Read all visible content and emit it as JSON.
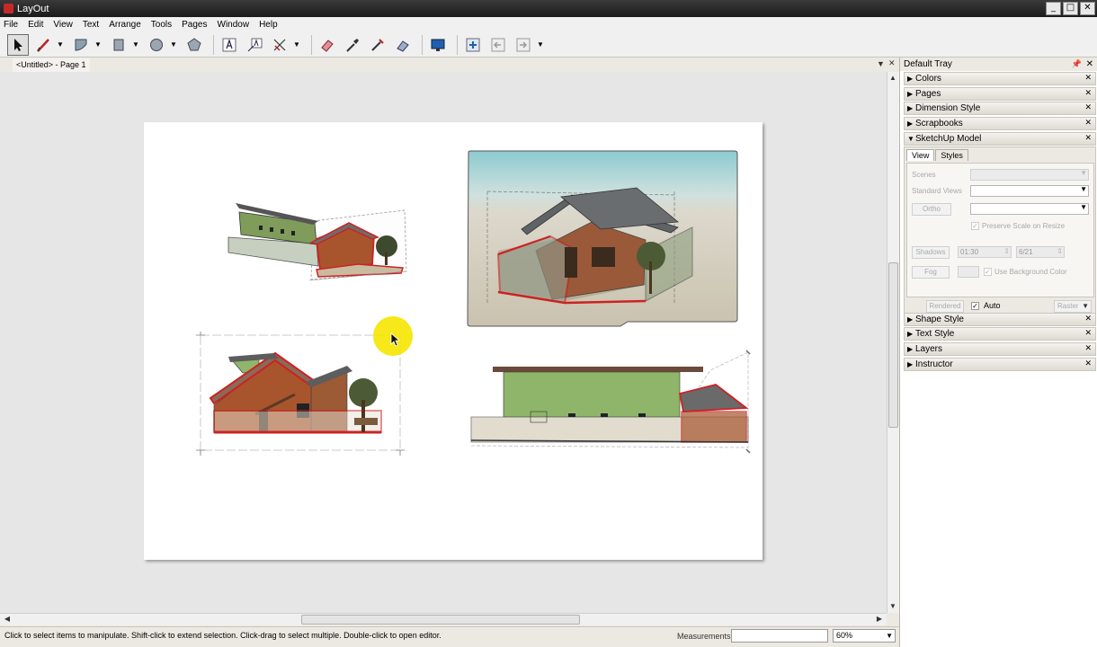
{
  "window": {
    "title": "LayOut",
    "min": "_",
    "max": "□",
    "close": "✕"
  },
  "menu": [
    "File",
    "Edit",
    "View",
    "Text",
    "Arrange",
    "Tools",
    "Pages",
    "Window",
    "Help"
  ],
  "toolbar": {
    "tools": [
      "select-icon",
      "line-icon",
      "arc-icon",
      "rectangle-icon",
      "circle-icon",
      "polygon-icon",
      "text-icon",
      "label-icon",
      "dimension-icon",
      "eraser-icon",
      "style-dropper-icon",
      "split-icon",
      "join-icon",
      "present-icon",
      "add-page-icon",
      "previous-page-icon",
      "next-page-icon"
    ]
  },
  "document": {
    "tab": "<Untitled> - Page 1"
  },
  "status": {
    "hint": "Click to select items to manipulate. Shift-click to extend selection. Click-drag to select multiple. Double-click to open editor.",
    "measurements_label": "Measurements",
    "measurements_value": "",
    "zoom": "60%"
  },
  "tray": {
    "title": "Default Tray",
    "panels_top": [
      "Colors",
      "Pages",
      "Dimension Style",
      "Scrapbooks"
    ],
    "sketchup": {
      "title": "SketchUp Model",
      "tabs": [
        "View",
        "Styles"
      ],
      "scenes_label": "Scenes",
      "standard_views_label": "Standard Views",
      "ortho_label": "Ortho",
      "preserve_scale": "Preserve Scale on Resize",
      "shadows_label": "Shadows",
      "time": "01:30",
      "date": "6/21",
      "fog_label": "Fog",
      "use_bg": "Use Background Color",
      "rendered_label": "Rendered",
      "auto_label": "Auto",
      "auto_checked": "✓",
      "raster_label": "Raster"
    },
    "panels_bottom": [
      "Shape Style",
      "Text Style",
      "Layers",
      "Instructor"
    ]
  },
  "colors": {
    "accent": "#cc2222",
    "wall_green": "#8fb56a",
    "brick": "#a8552e",
    "highlight": "#f5e600"
  }
}
